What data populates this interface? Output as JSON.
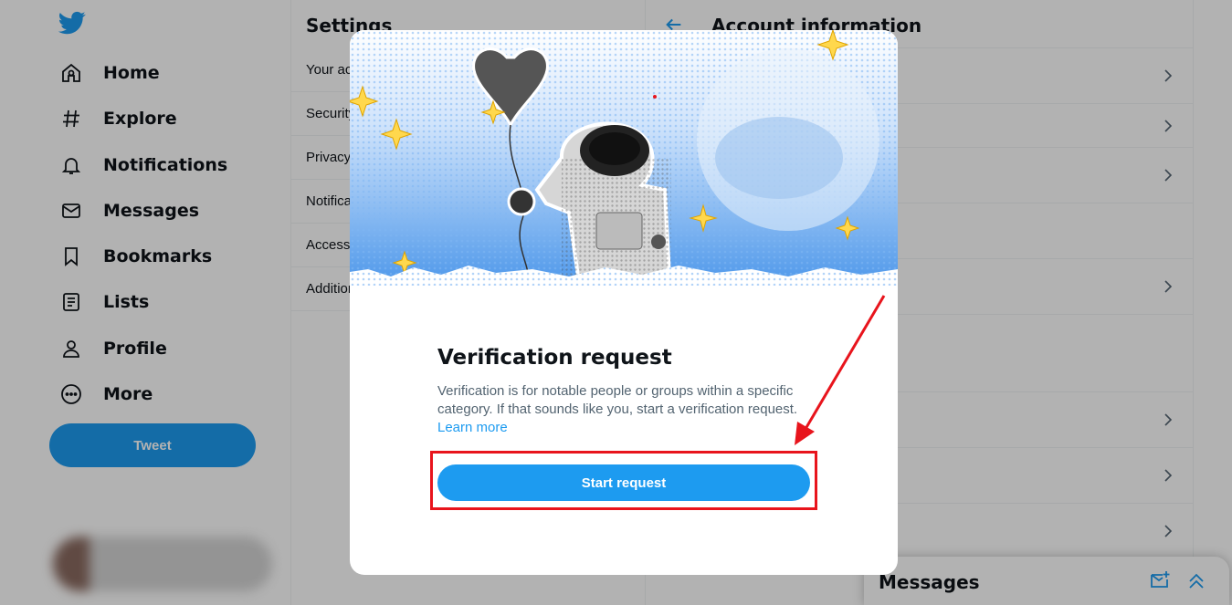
{
  "nav": {
    "items": [
      {
        "label": "Home",
        "icon": "home-icon"
      },
      {
        "label": "Explore",
        "icon": "hashtag-icon"
      },
      {
        "label": "Notifications",
        "icon": "bell-icon"
      },
      {
        "label": "Messages",
        "icon": "mail-icon"
      },
      {
        "label": "Bookmarks",
        "icon": "bookmark-icon"
      },
      {
        "label": "Lists",
        "icon": "list-icon"
      },
      {
        "label": "Profile",
        "icon": "person-icon"
      },
      {
        "label": "More",
        "icon": "more-circle-icon"
      }
    ],
    "tweet_label": "Tweet"
  },
  "settings": {
    "title": "Settings",
    "items": [
      "Your account",
      "Security and account access",
      "Privacy and safety",
      "Notifications",
      "Accessibility, display, and languages",
      "Additional resources"
    ]
  },
  "account": {
    "title": "Account information"
  },
  "messages_drawer": {
    "title": "Messages"
  },
  "modal": {
    "heading": "Verification request",
    "description": "Verification is for notable people or groups within a specific category. If that sounds like you, start a verification request.",
    "learn_more": "Learn more",
    "button_label": "Start request"
  },
  "colors": {
    "accent": "#1d9bf0",
    "annotation": "#e8141c"
  }
}
